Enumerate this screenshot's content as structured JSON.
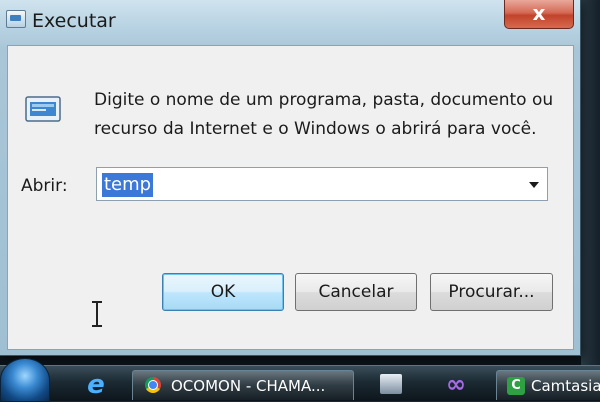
{
  "window": {
    "title": "Executar",
    "close_glyph": "x"
  },
  "dialog": {
    "description_line1": "Digite o nome de um programa, pasta, documento ou",
    "description_line2": "recurso da Internet e o Windows o abrirá para você.",
    "open_label": "Abrir:",
    "open_value": "temp",
    "ok_label": "OK",
    "cancel_label": "Cancelar",
    "browse_label": "Procurar..."
  },
  "taskbar": {
    "items": [
      {
        "label": "OCOMON - CHAMA...",
        "icon": "chrome-icon"
      },
      {
        "label": "Camtasia",
        "icon": "camtasia-icon"
      }
    ]
  },
  "colors": {
    "selection": "#3b78d8",
    "close_button": "#c1432b",
    "default_button_border": "#3c7fb1"
  }
}
